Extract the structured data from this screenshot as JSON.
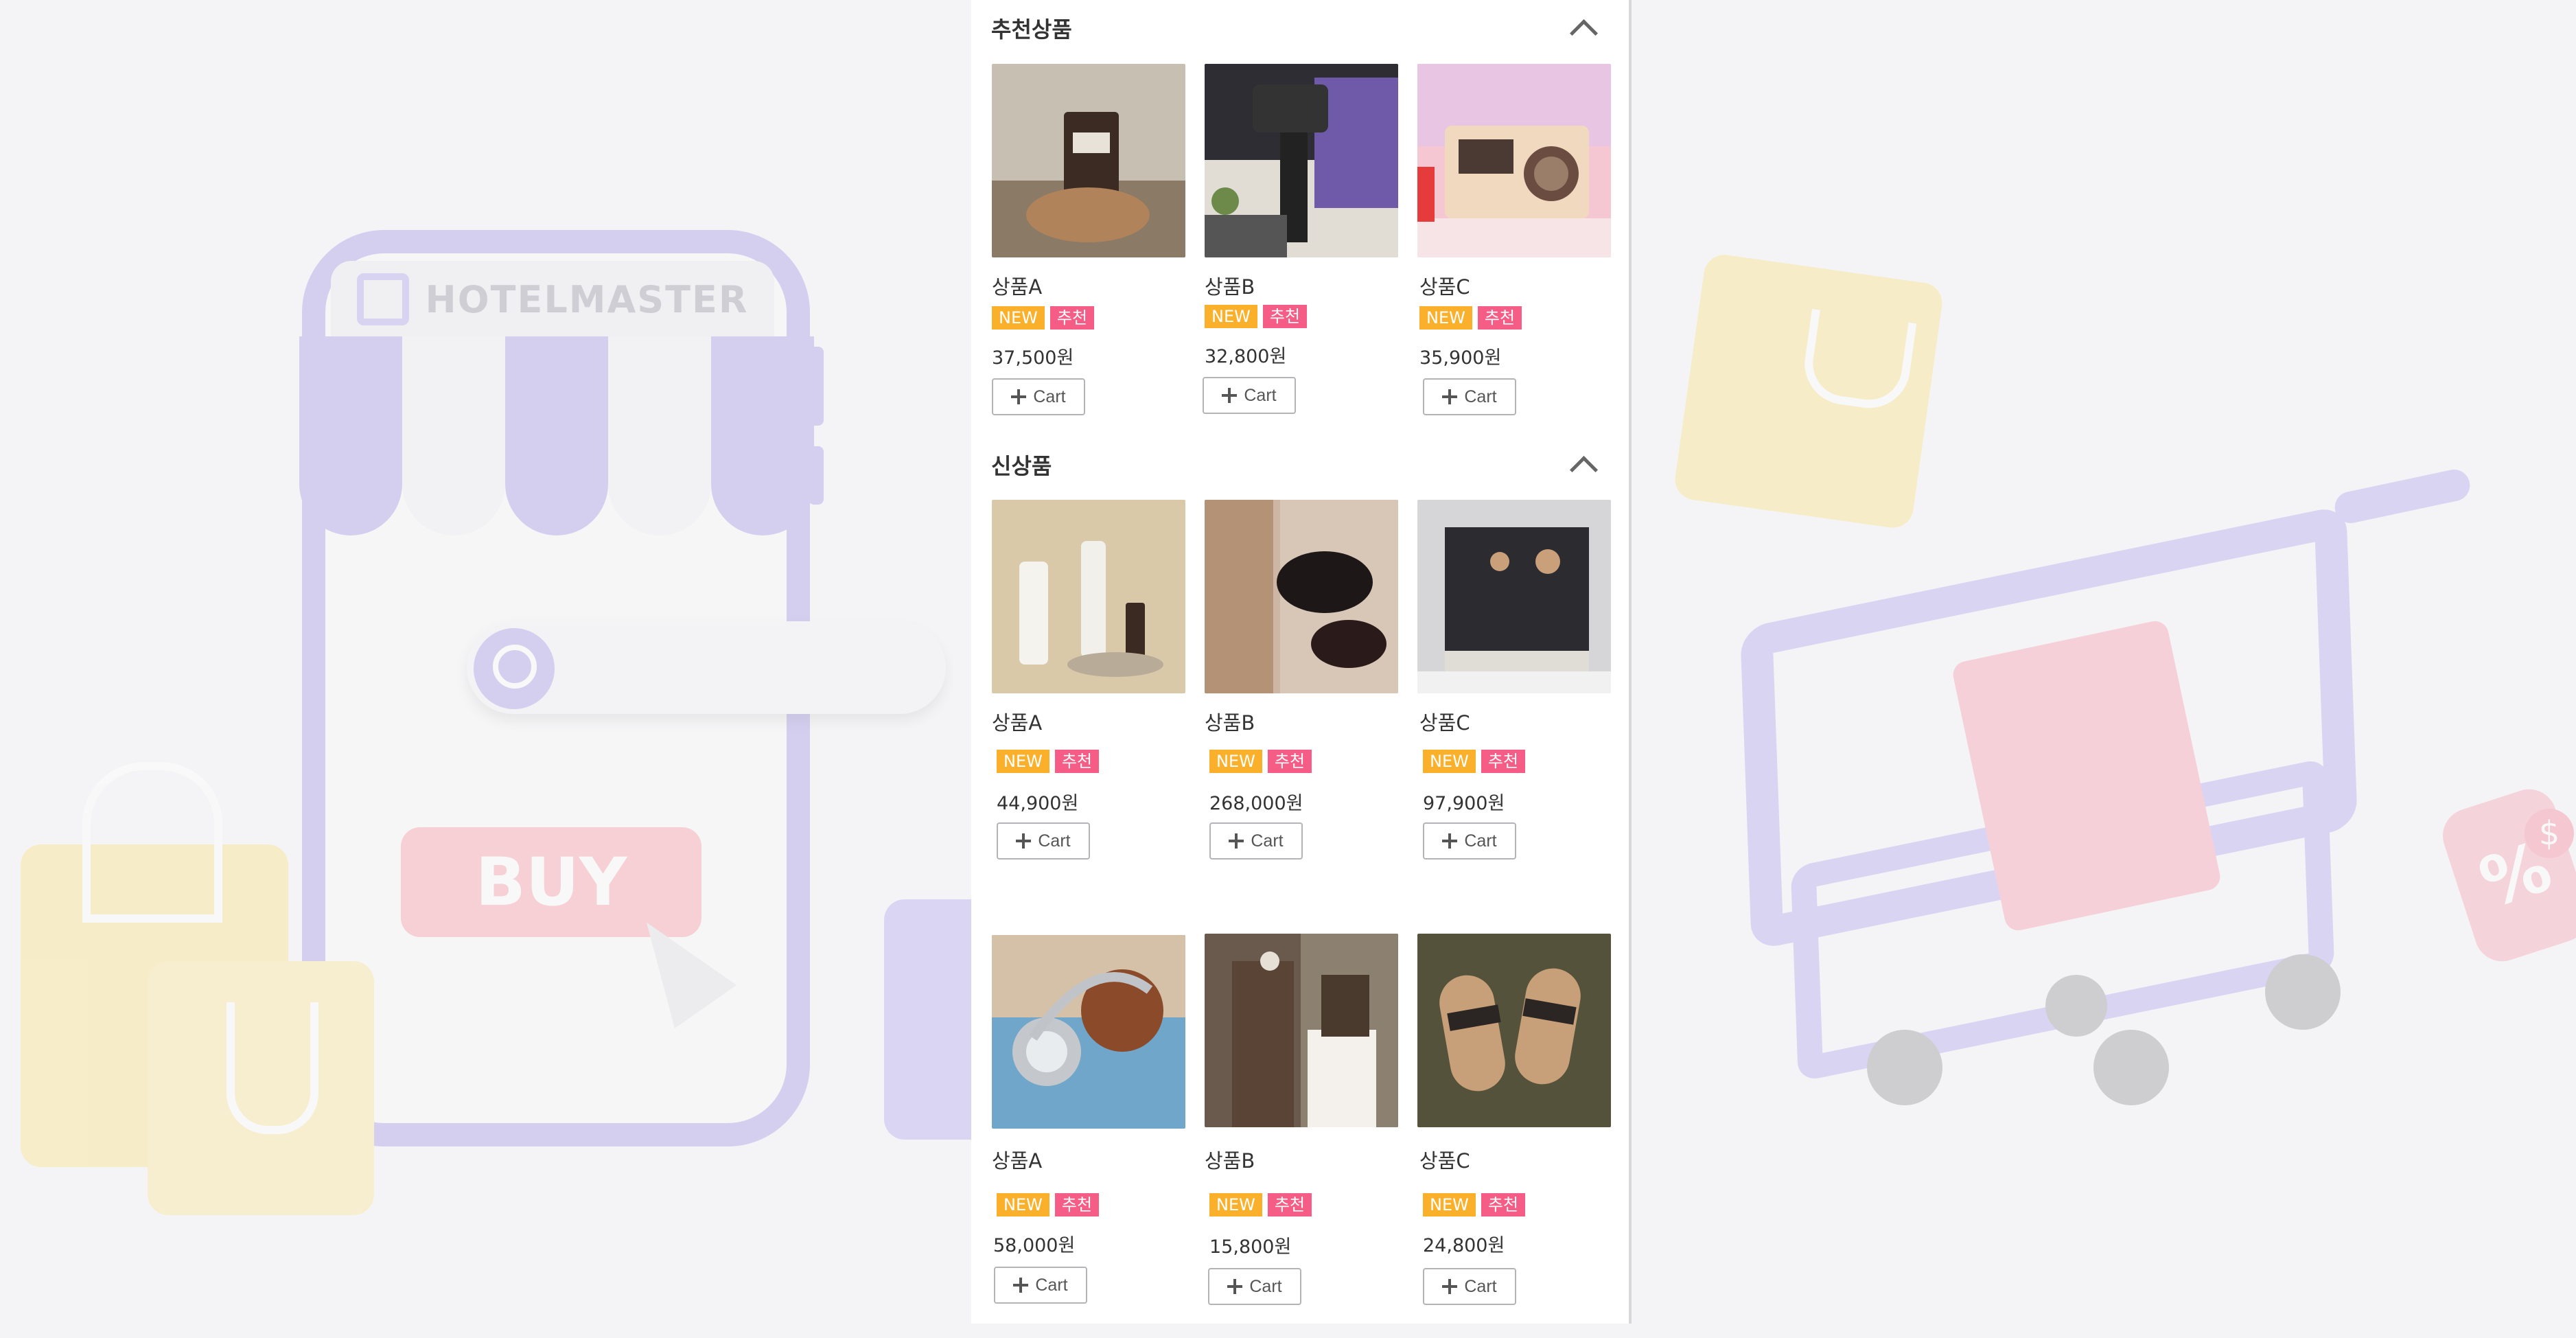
{
  "background": {
    "brand_text": "HOTELMASTER",
    "buy_text": "BUY",
    "tag_symbol": "%",
    "coin_symbol": "$",
    "colors": {
      "lavender": "#a99be6",
      "yellow": "#fbe388",
      "pink": "#f9a0a8",
      "panel": "#ffffff"
    }
  },
  "sections": [
    {
      "title": "추천상품",
      "collapse_icon": "chevron-up-icon",
      "products": [
        {
          "name": "상품A",
          "badges": [
            "NEW",
            "추천"
          ],
          "price": "37,500원",
          "cart_label": "Cart",
          "image": "candle"
        },
        {
          "name": "상품B",
          "badges": [
            "NEW",
            "추천"
          ],
          "price": "32,800원",
          "cart_label": "Cart",
          "image": "camera-gimbal"
        },
        {
          "name": "상품C",
          "badges": [
            "NEW",
            "추천"
          ],
          "price": "35,900원",
          "cart_label": "Cart",
          "image": "cassette-radio"
        }
      ]
    },
    {
      "title": "신상품",
      "collapse_icon": "chevron-up-icon",
      "products": [
        {
          "name": "상품A",
          "badges": [
            "NEW",
            "추천"
          ],
          "price": "44,900원",
          "cart_label": "Cart",
          "image": "cosmetics"
        },
        {
          "name": "상품B",
          "badges": [
            "NEW",
            "추천"
          ],
          "price": "268,000원",
          "cart_label": "Cart",
          "image": "sunglasses"
        },
        {
          "name": "상품C",
          "badges": [
            "NEW",
            "추천"
          ],
          "price": "97,900원",
          "cart_label": "Cart",
          "image": "espresso-machine"
        },
        {
          "name": "상품A",
          "badges": [
            "NEW",
            "추천"
          ],
          "price": "58,000원",
          "cart_label": "Cart",
          "image": "headphones"
        },
        {
          "name": "상품B",
          "badges": [
            "NEW",
            "추천"
          ],
          "price": "15,800원",
          "cart_label": "Cart",
          "image": "hair-clip"
        },
        {
          "name": "상품C",
          "badges": [
            "NEW",
            "추천"
          ],
          "price": "24,800원",
          "cart_label": "Cart",
          "image": "sandals"
        }
      ]
    }
  ]
}
